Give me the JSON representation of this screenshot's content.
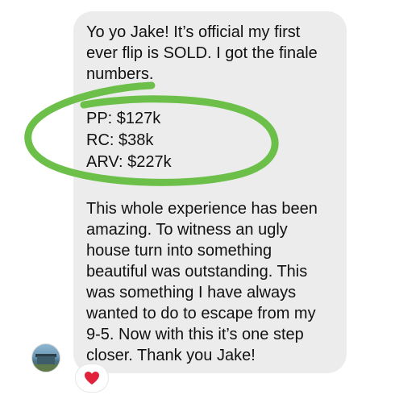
{
  "message": {
    "lines": [
      "Yo yo Jake! It’s official my first",
      "ever flip is SOLD. I got the finale",
      "numbers."
    ],
    "numbers": [
      "PP: $127k",
      "RC: $38k",
      "ARV: $227k"
    ],
    "closing_lines": [
      "This whole experience has been",
      "amazing. To witness an ugly",
      "house turn into something",
      "beautiful was outstanding. This",
      "was something I have always",
      "wanted to do to escape from  my",
      "9-5. Now with this it’s one step",
      "closer. Thank you Jake!"
    ]
  },
  "sender": {
    "avatar_icon": "profile-photo-house"
  },
  "reaction": {
    "icon": "red-heart-icon",
    "color": "#e0223b"
  },
  "highlight": {
    "color": "#6cc04a"
  },
  "colors": {
    "bubble": "#ececec",
    "text": "#111111"
  }
}
